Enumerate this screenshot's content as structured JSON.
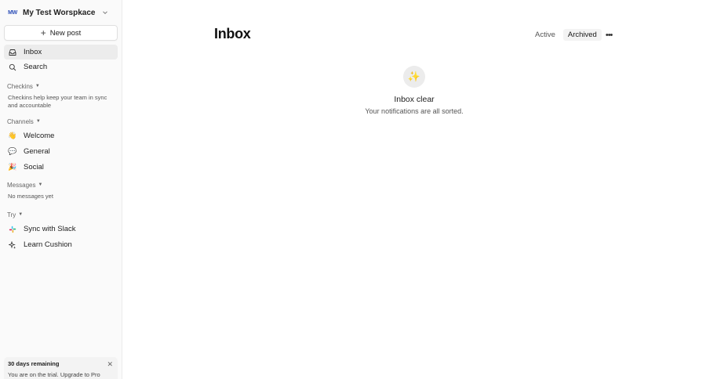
{
  "workspace": {
    "initials": "MW",
    "name": "My Test Worspkace"
  },
  "sidebar": {
    "new_post": "New post",
    "nav": [
      {
        "label": "Inbox",
        "icon": "inbox-icon"
      },
      {
        "label": "Search",
        "icon": "search-icon"
      }
    ],
    "checkins": {
      "header": "Checkins",
      "hint": "Checkins help keep your team in sync and accountable"
    },
    "channels": {
      "header": "Channels",
      "items": [
        {
          "label": "Welcome",
          "icon": "👋"
        },
        {
          "label": "General",
          "icon": "💬"
        },
        {
          "label": "Social",
          "icon": "🎉"
        }
      ]
    },
    "messages": {
      "header": "Messages",
      "empty": "No messages yet"
    },
    "try": {
      "header": "Try",
      "items": [
        {
          "label": "Sync with Slack",
          "icon": "slack-icon"
        },
        {
          "label": "Learn Cushion",
          "icon": "sparkle-icon"
        }
      ]
    },
    "trial": {
      "title": "30 days remaining",
      "body": "You are on the trial. Upgrade to Pro"
    }
  },
  "main": {
    "title": "Inbox",
    "tabs": [
      "Active",
      "Archived"
    ],
    "selected_tab": "Archived",
    "empty": {
      "icon": "✨",
      "title": "Inbox clear",
      "subtitle": "Your notifications are all sorted."
    }
  },
  "colors": {
    "sidebar_bg": "#fafafa",
    "active_item": "#ececec",
    "accent": "#2d4fb8"
  }
}
